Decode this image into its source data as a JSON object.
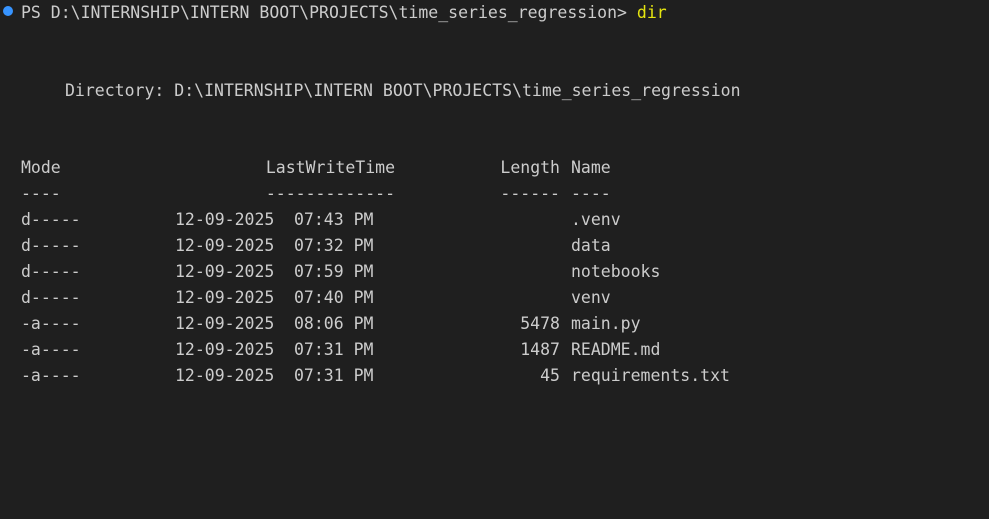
{
  "prompt": {
    "path": "PS D:\\INTERNSHIP\\INTERN BOOT\\PROJECTS\\time_series_regression>",
    "command": "dir",
    "status_color": "#3794ff"
  },
  "directory_label": "Directory: D:\\INTERNSHIP\\INTERN BOOT\\PROJECTS\\time_series_regression",
  "table": {
    "headers": {
      "mode": "Mode",
      "lastwrite": "LastWriteTime",
      "length": "Length",
      "name": "Name"
    },
    "separators": {
      "mode": "----",
      "lastwrite": "-------------",
      "length": "------",
      "name": "----"
    },
    "rows": [
      {
        "mode": "d-----",
        "date": "12-09-2025",
        "time": "07:43 PM",
        "length": "",
        "name": ".venv"
      },
      {
        "mode": "d-----",
        "date": "12-09-2025",
        "time": "07:32 PM",
        "length": "",
        "name": "data"
      },
      {
        "mode": "d-----",
        "date": "12-09-2025",
        "time": "07:59 PM",
        "length": "",
        "name": "notebooks"
      },
      {
        "mode": "d-----",
        "date": "12-09-2025",
        "time": "07:40 PM",
        "length": "",
        "name": "venv"
      },
      {
        "mode": "-a----",
        "date": "12-09-2025",
        "time": "08:06 PM",
        "length": "5478",
        "name": "main.py"
      },
      {
        "mode": "-a----",
        "date": "12-09-2025",
        "time": "07:31 PM",
        "length": "1487",
        "name": "README.md"
      },
      {
        "mode": "-a----",
        "date": "12-09-2025",
        "time": "07:31 PM",
        "length": "45",
        "name": "requirements.txt"
      }
    ]
  },
  "colors": {
    "background": "#1f1f1f",
    "text": "#cccccc",
    "command": "#e5e510"
  }
}
